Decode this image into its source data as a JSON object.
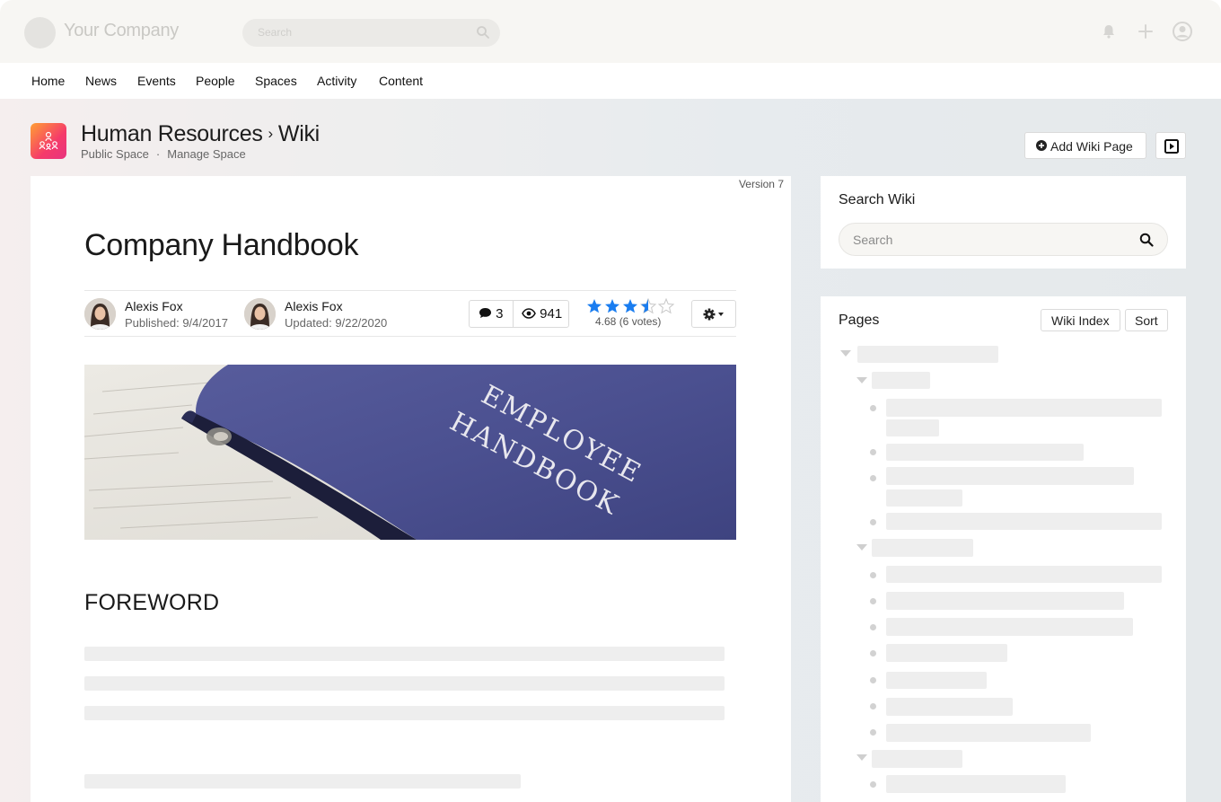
{
  "header": {
    "brand": "Your Company",
    "search_placeholder": "Search"
  },
  "nav": {
    "items": [
      "Home",
      "News",
      "Events",
      "People",
      "Spaces",
      "Activity",
      "Content"
    ]
  },
  "space": {
    "name": "Human Resources",
    "separator": "›",
    "section": "Wiki",
    "visibility": "Public Space",
    "dot": "·",
    "manage": "Manage Space",
    "add_wiki_label": "Add Wiki Page"
  },
  "article": {
    "version": "Version 7",
    "title": "Company Handbook",
    "author_published": {
      "name": "Alexis Fox",
      "date": "Published: 9/4/2017"
    },
    "author_updated": {
      "name": "Alexis Fox",
      "date": "Updated: 9/22/2020"
    },
    "comments": "3",
    "views": "941",
    "rating_value": 3.5,
    "rating_text": "4.68 (6 votes)",
    "hero_text_line1": "EMPLOYEE",
    "hero_text_line2": "HANDBOOK",
    "section_title": "FOREWORD"
  },
  "sidebar": {
    "search_title": "Search Wiki",
    "search_placeholder": "Search",
    "pages_title": "Pages",
    "wiki_index_label": "Wiki Index",
    "sort_label": "Sort"
  },
  "colors": {
    "star": "#1a7df0",
    "accent_gradient_start": "#ff9f33",
    "accent_gradient_end": "#e8337f",
    "book": "#4b4f8f"
  }
}
